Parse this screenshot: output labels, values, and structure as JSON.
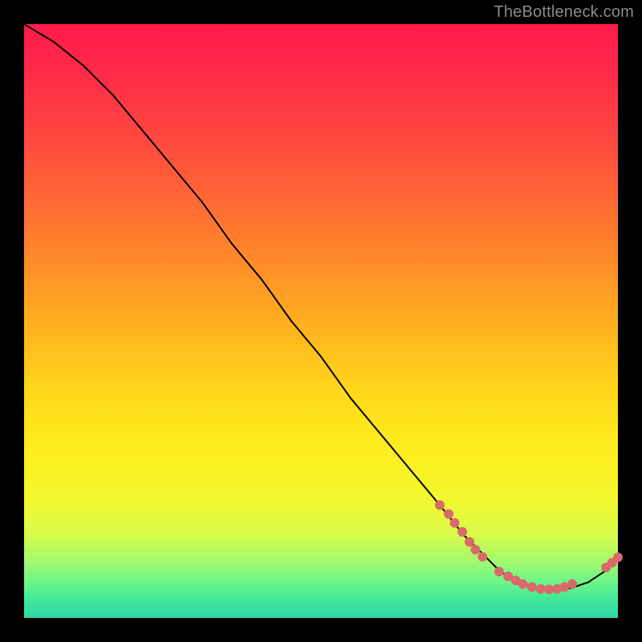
{
  "watermark": "TheBottleneck.com",
  "chart_data": {
    "type": "line",
    "title": "",
    "xlabel": "",
    "ylabel": "",
    "xlim": [
      0,
      100
    ],
    "ylim": [
      0,
      100
    ],
    "grid": false,
    "legend": false,
    "series": [
      {
        "name": "bottleneck-curve",
        "x": [
          0,
          5,
          10,
          15,
          20,
          25,
          30,
          35,
          40,
          45,
          50,
          55,
          60,
          65,
          70,
          74,
          77,
          80,
          83,
          86,
          89,
          92,
          95,
          98,
          100
        ],
        "y": [
          100,
          97,
          93,
          88,
          82,
          76,
          70,
          63,
          57,
          50,
          44,
          37,
          31,
          25,
          19,
          14,
          11,
          8,
          6,
          5,
          4.5,
          5,
          6,
          8,
          10
        ]
      }
    ],
    "markers": [
      {
        "x": 70.0,
        "y": 19.0
      },
      {
        "x": 71.5,
        "y": 17.5
      },
      {
        "x": 72.5,
        "y": 16.0
      },
      {
        "x": 73.8,
        "y": 14.5
      },
      {
        "x": 75.0,
        "y": 12.8
      },
      {
        "x": 76.0,
        "y": 11.5
      },
      {
        "x": 77.2,
        "y": 10.3
      },
      {
        "x": 80.0,
        "y": 7.8
      },
      {
        "x": 81.5,
        "y": 7.0
      },
      {
        "x": 82.8,
        "y": 6.3
      },
      {
        "x": 84.0,
        "y": 5.7
      },
      {
        "x": 85.5,
        "y": 5.2
      },
      {
        "x": 87.0,
        "y": 4.9
      },
      {
        "x": 88.4,
        "y": 4.8
      },
      {
        "x": 89.8,
        "y": 4.9
      },
      {
        "x": 91.0,
        "y": 5.2
      },
      {
        "x": 92.3,
        "y": 5.7
      },
      {
        "x": 98.0,
        "y": 8.5
      },
      {
        "x": 99.0,
        "y": 9.3
      },
      {
        "x": 100.0,
        "y": 10.2
      }
    ],
    "marker_color": "#d86a6a",
    "line_color": "#000000",
    "gradient_stops": [
      {
        "pos": 0.0,
        "color": "#ff1a4b"
      },
      {
        "pos": 0.5,
        "color": "#ffd81a"
      },
      {
        "pos": 0.85,
        "color": "#d8fb4a"
      },
      {
        "pos": 1.0,
        "color": "#2fd8a6"
      }
    ]
  }
}
